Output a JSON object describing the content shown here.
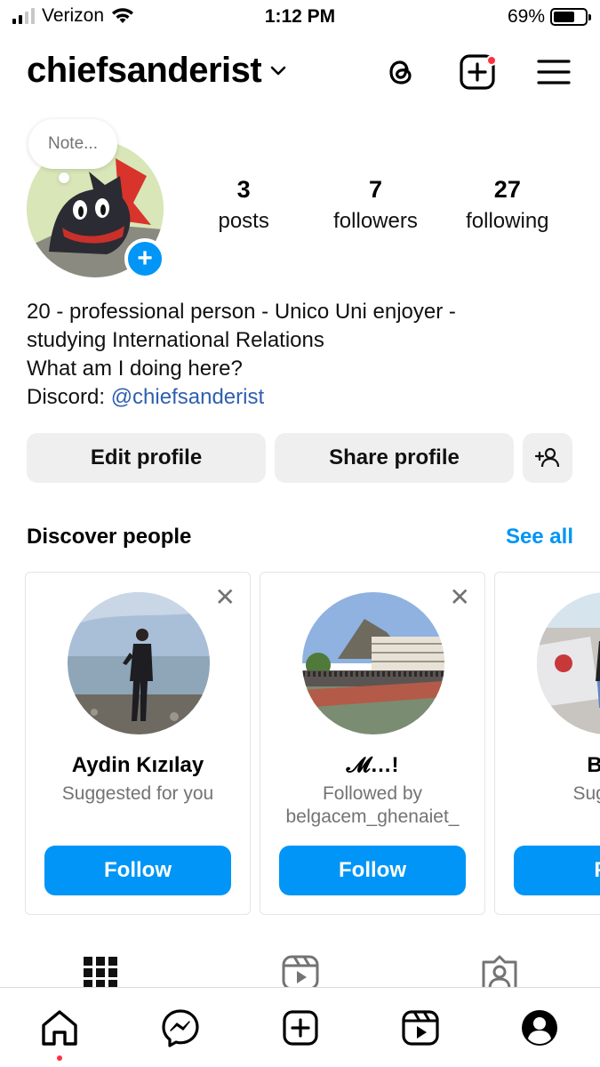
{
  "status_bar": {
    "carrier": "Verizon",
    "time": "1:12 PM",
    "battery_percent": "69%",
    "battery_level": 0.69,
    "signal_bars": 2,
    "icons": [
      "signal-icon",
      "wifi-icon",
      "battery-icon"
    ]
  },
  "header": {
    "username": "chiefsanderist",
    "icons": [
      "chevron-down-icon",
      "threads-icon",
      "create-post-icon",
      "menu-icon"
    ]
  },
  "profile": {
    "note_placeholder": "Note...",
    "add_story_symbol": "+",
    "stats": [
      {
        "value": "3",
        "label": "posts"
      },
      {
        "value": "7",
        "label": "followers"
      },
      {
        "value": "27",
        "label": "following"
      }
    ],
    "bio_lines": [
      "20 - professional person - Unico Uni enjoyer -",
      "studying International Relations",
      "What am I doing here?"
    ],
    "discord_prefix": "Discord: ",
    "discord_handle": "@chiefsanderist"
  },
  "actions": {
    "edit_profile": "Edit profile",
    "share_profile": "Share profile"
  },
  "discover": {
    "title": "Discover people",
    "see_all": "See all",
    "cards": [
      {
        "name": "Aydin Kızılay",
        "subtitle_1": "Suggested for you",
        "subtitle_2": "",
        "follow": "Follow"
      },
      {
        "name": "𝓜…!",
        "subtitle_1": "Followed by",
        "subtitle_2": "belgacem_ghenaiet_",
        "follow": "Follow"
      },
      {
        "name": "Bãd",
        "subtitle_1": "Suggest",
        "subtitle_2": "",
        "follow": "Fo"
      }
    ]
  },
  "colors": {
    "accent": "#0095f6",
    "notification": "#ff3040",
    "mention_link": "#2e5fb0"
  }
}
